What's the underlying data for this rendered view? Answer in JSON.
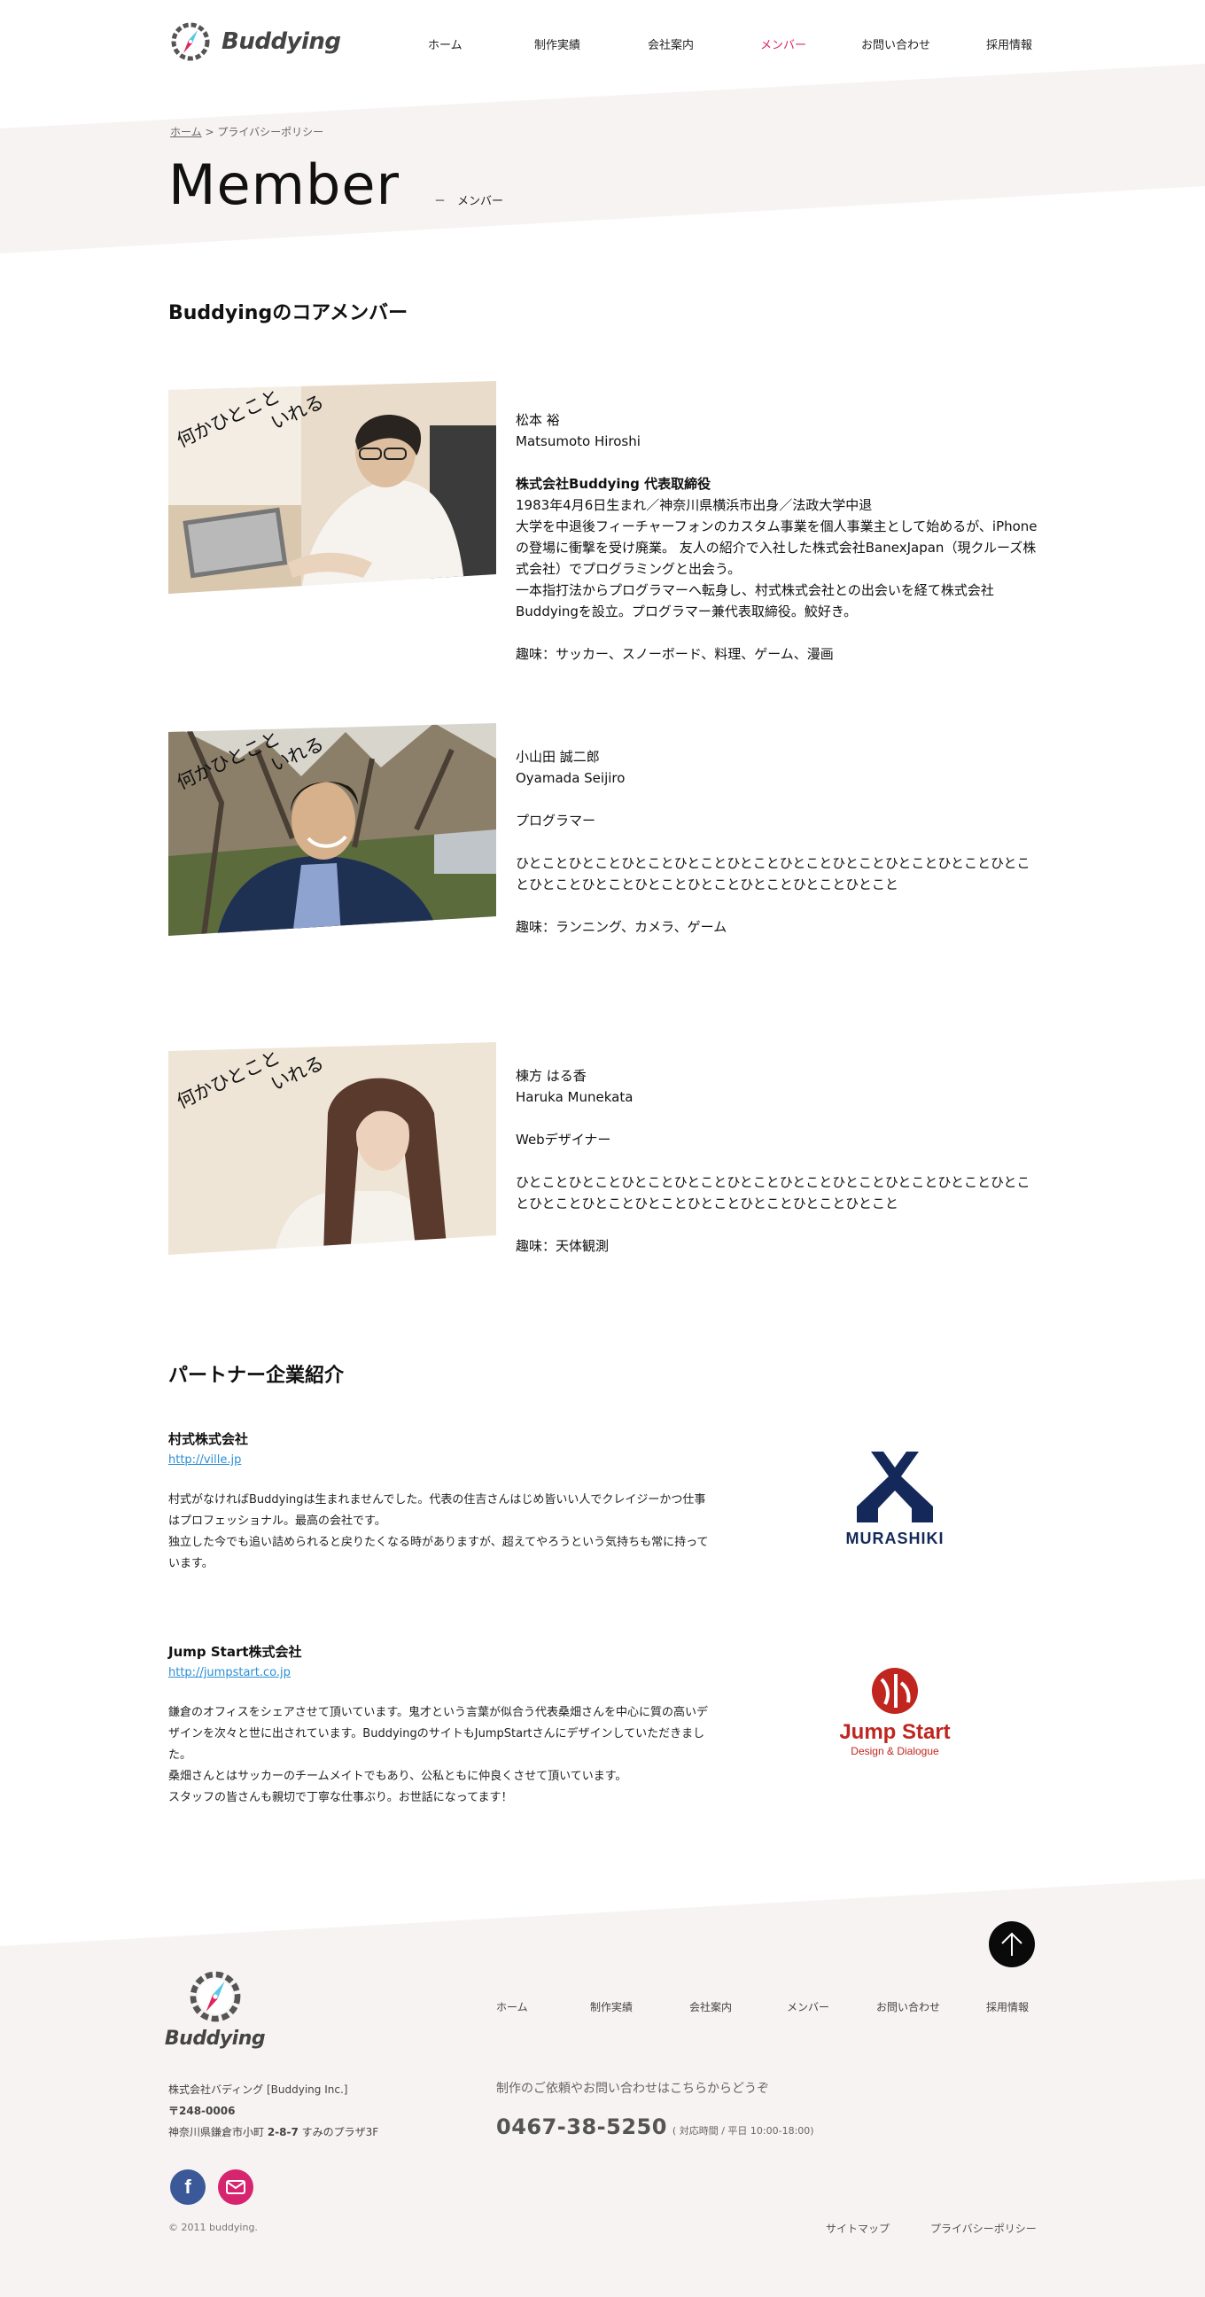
{
  "colors": {
    "accent": "#e0245e",
    "link": "#2a8fd6",
    "band": "#f7f3f2",
    "muraskiki_navy": "#14295a",
    "jumpstart_red": "#c0261f"
  },
  "header": {
    "logo_text": "Buddying",
    "nav": [
      {
        "label": "ホーム",
        "active": false
      },
      {
        "label": "制作実績",
        "active": false
      },
      {
        "label": "会社案内",
        "active": false
      },
      {
        "label": "メンバー",
        "active": true
      },
      {
        "label": "お問い合わせ",
        "active": false
      },
      {
        "label": "採用情報",
        "active": false
      }
    ]
  },
  "breadcrumb": {
    "home": "ホーム",
    "separator": ">",
    "current": "プライバシーポリシー"
  },
  "page": {
    "title": "Member",
    "subtitle": "－　メンバー"
  },
  "core_members": {
    "title": "Buddyingのコアメンバー",
    "photo_caption_1": "何かひとこと",
    "photo_caption_2": "いれる",
    "members": [
      {
        "name_ja": "松本 裕",
        "name_en": "Matsumoto Hiroshi",
        "role": "株式会社Buddying 代表取締役",
        "bio": [
          "1983年4月6日生まれ／神奈川県横浜市出身／法政大学中退",
          "大学を中退後フィーチャーフォンのカスタム事業を個人事業主として始めるが、iPhoneの登場に衝撃を受け廃業。 友人の紹介で入社した株式会社BanexJapan（現クルーズ株式会社）でプログラミングと出会う。",
          "一本指打法からプログラマーへ転身し、村式株式会社との出会いを経て株式会社Buddyingを設立。プログラマー兼代表取締役。鮫好き。"
        ],
        "hobby": "趣味：サッカー、スノーボード、料理、ゲーム、漫画"
      },
      {
        "name_ja": "小山田 誠二郎",
        "name_en": "Oyamada Seijiro",
        "role": "プログラマー",
        "bio": [
          "ひとことひとことひとことひとことひとことひとことひとことひとことひとことひとことひとことひとことひとことひとことひとことひとことひとこと"
        ],
        "hobby": "趣味：ランニング、カメラ、ゲーム"
      },
      {
        "name_ja": "棟方 はる香",
        "name_en": "Haruka Munekata",
        "role": "Webデザイナー",
        "bio": [
          "ひとことひとことひとことひとことひとことひとことひとことひとことひとことひとことひとことひとことひとことひとことひとことひとことひとこと"
        ],
        "hobby": "趣味：天体観測"
      }
    ]
  },
  "partners": {
    "title": "パートナー企業紹介",
    "items": [
      {
        "name": "村式株式会社",
        "url": "http://ville.jp",
        "desc": [
          "村式がなければBuddyingは生まれませんでした。代表の住吉さんはじめ皆いい人でクレイジーかつ仕事はプロフェッショナル。最高の会社です。",
          "独立した今でも追い詰められると戻りたくなる時がありますが、超えてやろうという気持ちも常に持っています。"
        ],
        "logo_text": "MURASHIKI"
      },
      {
        "name": "Jump Start株式会社",
        "url": "http://jumpstart.co.jp",
        "desc": [
          "鎌倉のオフィスをシェアさせて頂いています。鬼才という言葉が似合う代表桑畑さんを中心に質の高いデザインを次々と世に出されています。BuddyingのサイトもJumpStartさんにデザインしていただきました。",
          "桑畑さんとはサッカーのチームメイトでもあり、公私ともに仲良くさせて頂いています。",
          "スタッフの皆さんも親切で丁寧な仕事ぶり。お世話になってます！"
        ],
        "logo_text": "Jump Start",
        "logo_sub": "Design & Dialogue"
      }
    ]
  },
  "footer": {
    "logo_text": "Buddying",
    "nav": [
      "ホーム",
      "制作実績",
      "会社案内",
      "メンバー",
      "お問い合わせ",
      "採用情報"
    ],
    "company_name": "株式会社バディング [Buddying Inc.]",
    "postal": "〒248-0006",
    "address_prefix": "神奈川県鎌倉市小町 ",
    "address_bold": "2-8-7",
    "address_suffix": " すみのプラザ3F",
    "contact_message": "制作のご依頼やお問い合わせはこちらからどうぞ",
    "phone": "0467-38-5250",
    "hours": "( 対応時間 / 平日 10:00-18:00)",
    "copyright": "© 2011 buddying.",
    "links": [
      "サイトマップ",
      "プライバシーポリシー"
    ]
  }
}
